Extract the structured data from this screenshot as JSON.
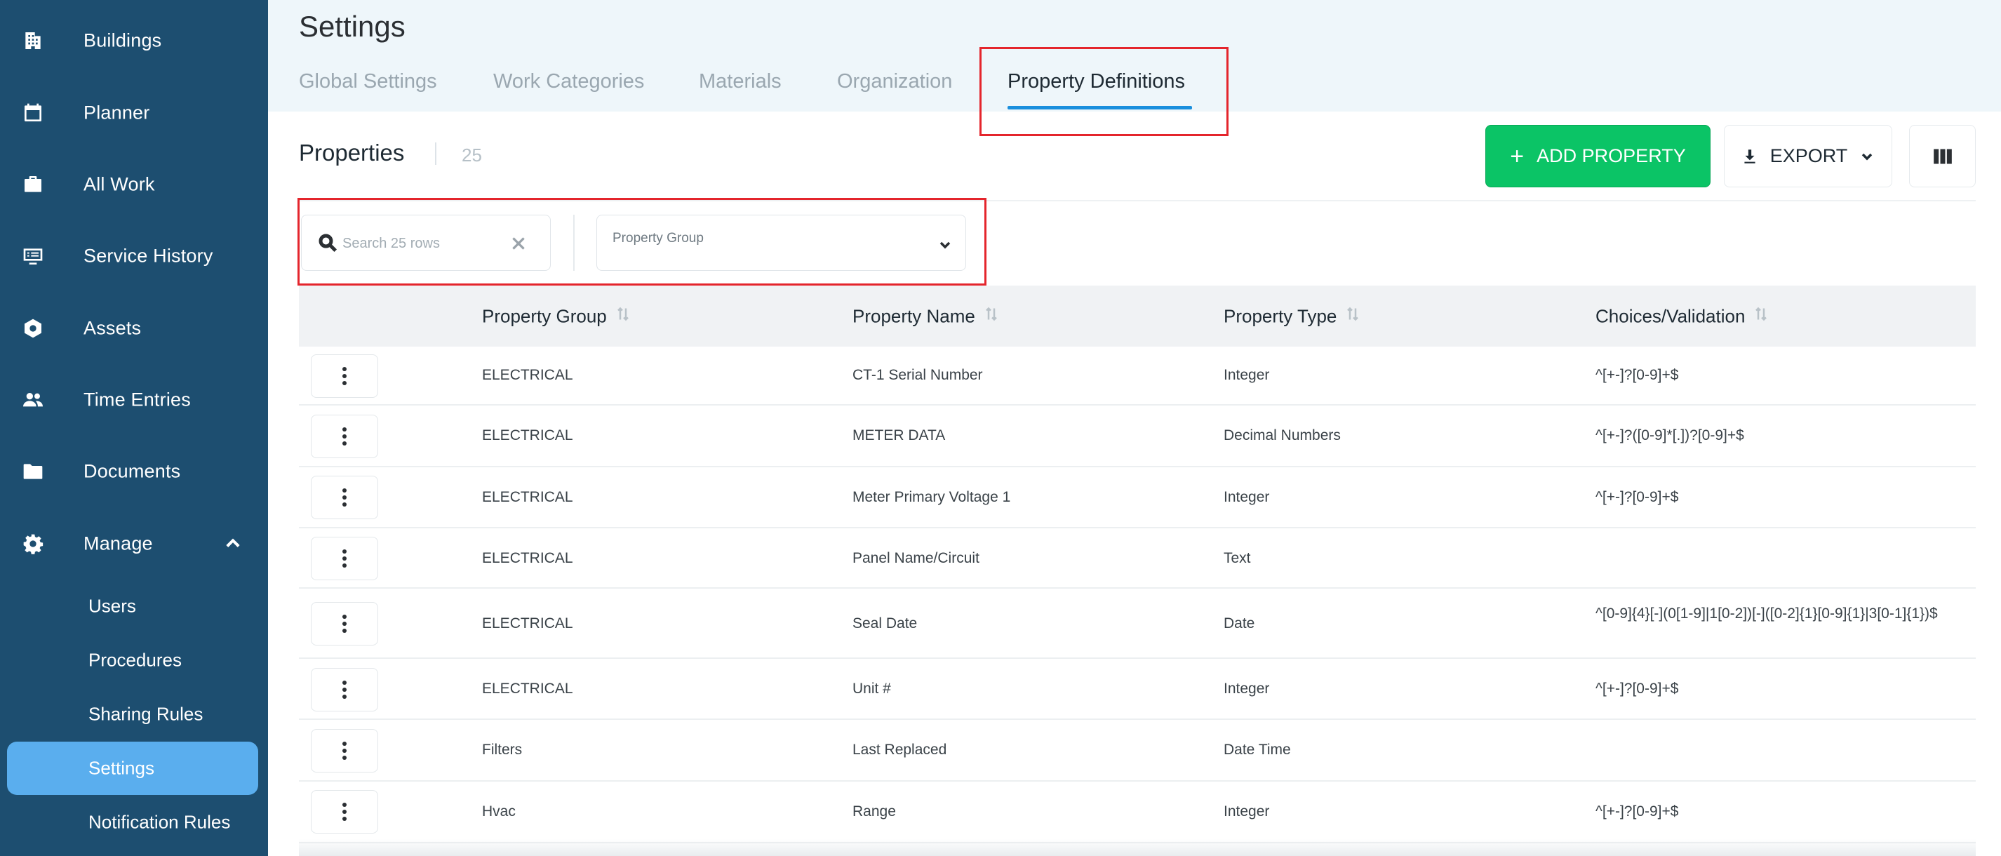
{
  "sidebar": {
    "items": [
      {
        "label": "Buildings",
        "icon": "building-icon"
      },
      {
        "label": "Planner",
        "icon": "calendar-icon"
      },
      {
        "label": "All Work",
        "icon": "briefcase-icon"
      },
      {
        "label": "Service History",
        "icon": "list-icon"
      },
      {
        "label": "Assets",
        "icon": "hexagon-icon"
      },
      {
        "label": "Time Entries",
        "icon": "people-icon"
      },
      {
        "label": "Documents",
        "icon": "folder-icon"
      },
      {
        "label": "Manage",
        "icon": "gear-icon",
        "expanded": true
      }
    ],
    "sub_items": [
      {
        "label": "Users",
        "active": false
      },
      {
        "label": "Procedures",
        "active": false
      },
      {
        "label": "Sharing Rules",
        "active": false
      },
      {
        "label": "Settings",
        "active": true
      },
      {
        "label": "Notification Rules",
        "active": false
      }
    ]
  },
  "header": {
    "title": "Settings",
    "tabs": [
      {
        "label": "Global Settings",
        "active": false
      },
      {
        "label": "Work Categories",
        "active": false
      },
      {
        "label": "Materials",
        "active": false
      },
      {
        "label": "Organization",
        "active": false
      },
      {
        "label": "Property Definitions",
        "active": true
      }
    ]
  },
  "toolbar": {
    "title": "Properties",
    "count": "25",
    "add_label": "ADD PROPERTY",
    "export_label": "EXPORT"
  },
  "filters": {
    "search_placeholder": "Search 25 rows",
    "search_value": "",
    "group_label": "Property Group"
  },
  "table": {
    "columns": [
      "Property Group",
      "Property Name",
      "Property Type",
      "Choices/Validation"
    ],
    "rows": [
      {
        "group": "ELECTRICAL",
        "name": "CT-1 Serial Number",
        "type": "Integer",
        "choices": "^[+-]?[0-9]+$"
      },
      {
        "group": "ELECTRICAL",
        "name": "METER DATA",
        "type": "Decimal Numbers",
        "choices": "^[+-]?([0-9]*[.])?[0-9]+$"
      },
      {
        "group": "ELECTRICAL",
        "name": "Meter Primary Voltage 1",
        "type": "Integer",
        "choices": "^[+-]?[0-9]+$"
      },
      {
        "group": "ELECTRICAL",
        "name": "Panel Name/Circuit",
        "type": "Text",
        "choices": ""
      },
      {
        "group": "ELECTRICAL",
        "name": "Seal Date",
        "type": "Date",
        "choices": "^[0-9]{4}[-](0[1-9]|1[0-2])[-]([0-2]{1}[0-9]{1}|3[0-1]{1})$"
      },
      {
        "group": "ELECTRICAL",
        "name": "Unit #",
        "type": "Integer",
        "choices": "^[+-]?[0-9]+$"
      },
      {
        "group": "Filters",
        "name": "Last Replaced",
        "type": "Date Time",
        "choices": ""
      },
      {
        "group": "Hvac",
        "name": "Range",
        "type": "Integer",
        "choices": "^[+-]?[0-9]+$"
      }
    ]
  },
  "colors": {
    "sidebar_bg": "#1d4e70",
    "sidebar_active": "#5aaeee",
    "header_bg": "#eef6fa",
    "accent": "#1a8fdd",
    "add_button": "#0bc466",
    "highlight_box": "#e4252c"
  }
}
